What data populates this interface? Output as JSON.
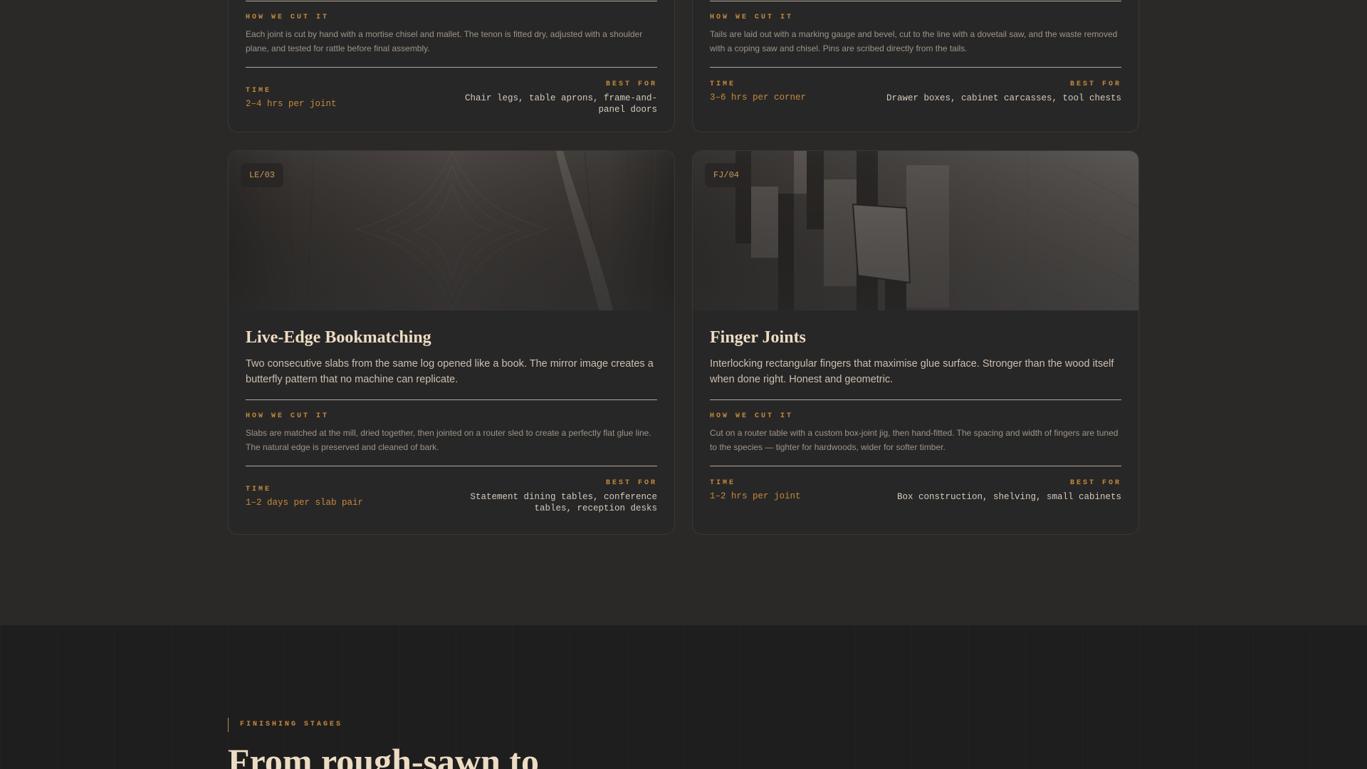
{
  "top_cards": [
    {
      "how_label": "HOW WE CUT IT",
      "how_text": "Each joint is cut by hand with a mortise chisel and mallet. The tenon is fitted dry, adjusted with a shoulder plane, and tested for rattle before final assembly.",
      "time_label": "TIME",
      "time_value": "2–4 hrs per joint",
      "best_label": "BEST FOR",
      "best_value": "Chair legs, table aprons, frame-and-panel doors"
    },
    {
      "how_label": "HOW WE CUT IT",
      "how_text": "Tails are laid out with a marking gauge and bevel, cut to the line with a dovetail saw, and the waste removed with a coping saw and chisel. Pins are scribed directly from the tails.",
      "time_label": "TIME",
      "time_value": "3–6 hrs per corner",
      "best_label": "BEST FOR",
      "best_value": "Drawer boxes, cabinet carcasses, tool chests"
    }
  ],
  "bottom_cards": [
    {
      "code": "LE/03",
      "title": "Live-Edge Bookmatching",
      "description": "Two consecutive slabs from the same log opened like a book. The mirror image creates a butterfly pattern that no machine can replicate.",
      "how_label": "HOW WE CUT IT",
      "how_text": "Slabs are matched at the mill, dried together, then jointed on a router sled to create a perfectly flat glue line. The natural edge is preserved and cleaned of bark.",
      "time_label": "TIME",
      "time_value": "1–2 days per slab pair",
      "best_label": "BEST FOR",
      "best_value": "Statement dining tables, conference tables, reception desks"
    },
    {
      "code": "FJ/04",
      "title": "Finger Joints",
      "description": "Interlocking rectangular fingers that maximise glue surface. Stronger than the wood itself when done right. Honest and geometric.",
      "how_label": "HOW WE CUT IT",
      "how_text": "Cut on a router table with a custom box-joint jig, then hand-fitted. The spacing and width of fingers are tuned to the species — tighter for hardwoods, wider for softer timber.",
      "time_label": "TIME",
      "time_value": "1–2 hrs per joint",
      "best_label": "BEST FOR",
      "best_value": "Box construction, shelving, small cabinets"
    }
  ],
  "finishing_section": {
    "eyebrow": "FINISHING STAGES",
    "heading": "From rough-sawn to"
  },
  "colors": {
    "accent": "#c48a3e",
    "page_bg": "#2a2928",
    "section_bg": "#1f1e1e",
    "heading": "#ecdcc4"
  }
}
